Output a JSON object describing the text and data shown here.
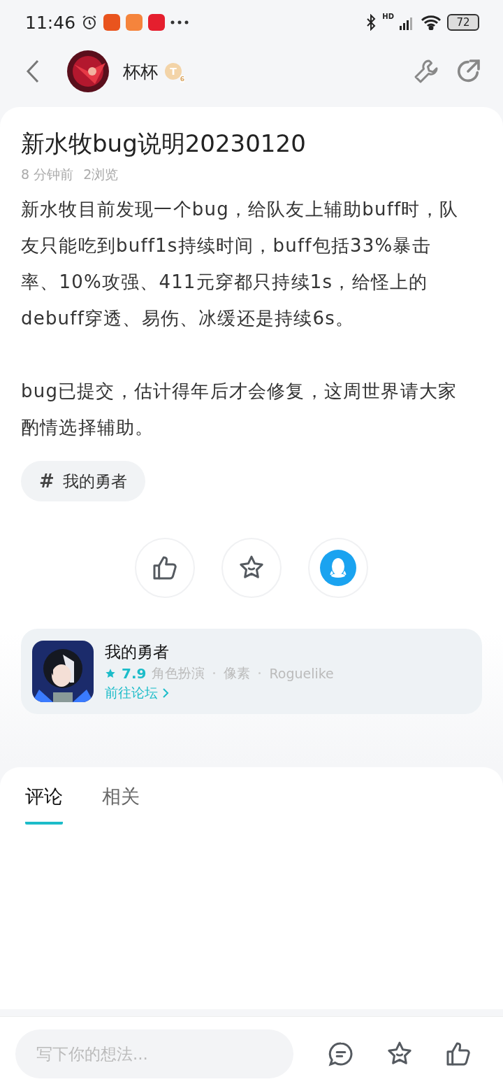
{
  "status_bar": {
    "time": "11:46",
    "network_label": "HD",
    "battery": "72"
  },
  "header": {
    "author": "杯杯",
    "badge": {
      "letter": "T",
      "level": "6"
    }
  },
  "post": {
    "title": "新水牧bug说明20230120",
    "time": "8 分钟前",
    "views": "2浏览",
    "paragraphs": [
      "新水牧目前发现一个bug，给队友上辅助buff时，队友只能吃到buff1s持续时间，buff包括33%暴击率、10%攻强、411元穿都只持续1s，给怪上的debuff穿透、易伤、冰缓还是持续6s。",
      "bug已提交，估计得年后才会修复，这周世界请大家酌情选择辅助。"
    ],
    "tag": {
      "symbol": "#",
      "label": "我的勇者"
    }
  },
  "game": {
    "name": "我的勇者",
    "rating": "7.9",
    "tags": [
      "角色扮演",
      "像素",
      "Roguelike"
    ],
    "link": "前往论坛"
  },
  "tabs": [
    {
      "label": "评论",
      "selected": true
    },
    {
      "label": "相关",
      "selected": false
    }
  ],
  "comment_box": {
    "placeholder": "写下你的想法..."
  }
}
